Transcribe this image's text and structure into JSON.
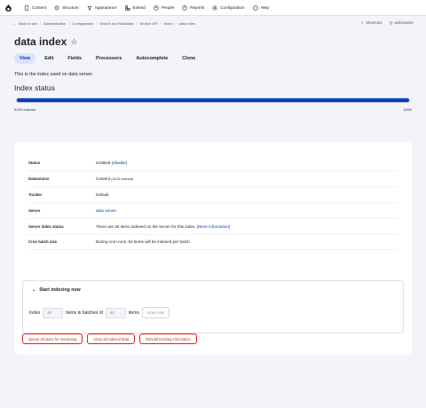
{
  "toolbar": {
    "items": [
      {
        "label": "Content",
        "icon": "document-icon"
      },
      {
        "label": "Structure",
        "icon": "structure-icon"
      },
      {
        "label": "Appearance",
        "icon": "appearance-icon"
      },
      {
        "label": "Extend",
        "icon": "extend-icon"
      },
      {
        "label": "People",
        "icon": "people-icon"
      },
      {
        "label": "Reports",
        "icon": "reports-icon"
      },
      {
        "label": "Configuration",
        "icon": "gear-icon"
      },
      {
        "label": "Help",
        "icon": "help-icon"
      }
    ]
  },
  "breadcrumb": {
    "back": "Back to site",
    "items": [
      "Administration",
      "Configuration",
      "Search and Metadata",
      "Search API",
      "Index",
      "data index"
    ]
  },
  "user": {
    "shortcuts": "Shortcuts",
    "name": "webmaster"
  },
  "page": {
    "title": "data index",
    "description": "This is the index used on data server."
  },
  "tabs": [
    "View",
    "Edit",
    "Fields",
    "Processors",
    "Autocomplete",
    "Clone"
  ],
  "index_status": {
    "heading": "Index status",
    "indexed_text": "31/31 indexed",
    "percent_text": "100%",
    "progress": 1.0
  },
  "details": {
    "status_label": "Status",
    "status_value": "enabled",
    "status_link": "disable",
    "datasource_label": "Datasource",
    "datasource_value": "Content",
    "datasource_count": "(31/31 indexed)",
    "tracker_label": "Tracker",
    "tracker_value": "Default",
    "server_label": "Server",
    "server_value": "data server",
    "server_status_label": "Server index status",
    "server_status_value": "There are 30 items indexed on the server for this index.",
    "server_status_link": "More information",
    "cron_label": "Cron batch size",
    "cron_value": "During cron runs, 50 items will be indexed per batch."
  },
  "indexing": {
    "summary": "Start indexing now",
    "index_label": "Index",
    "index_placeholder": "all",
    "batches_label": "items in batches of",
    "batch_placeholder": "50",
    "items_label": "items",
    "index_now": "Index now"
  },
  "actions": {
    "queue": "Queue all items for reindexing",
    "clear": "Clear all indexed data",
    "rebuild": "Rebuild tracking information"
  },
  "colors": {
    "accent": "#003ecc",
    "danger": "#d72222"
  }
}
